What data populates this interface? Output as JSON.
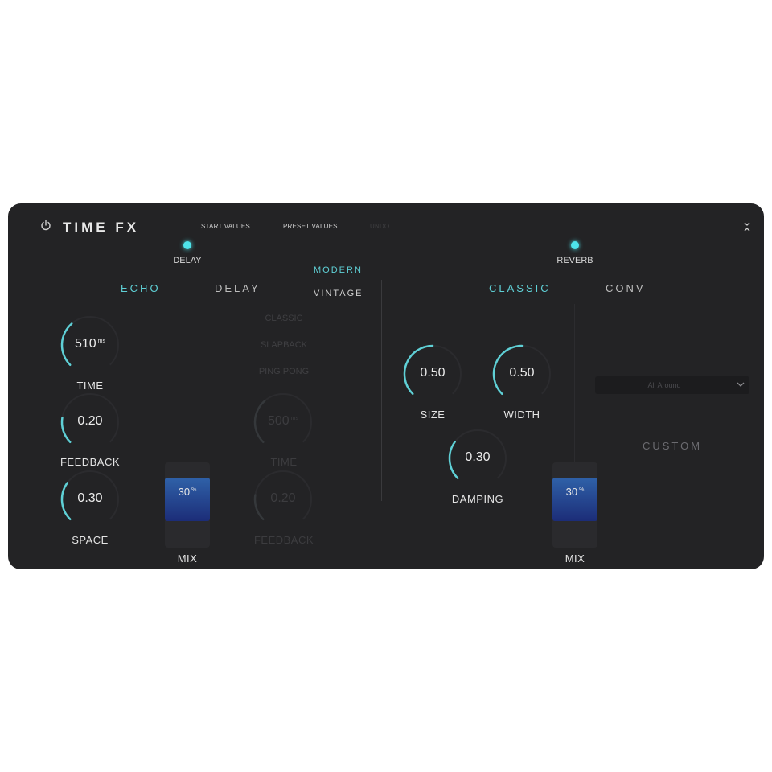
{
  "header": {
    "title": "TIME FX",
    "start_values": "START VALUES",
    "preset_values": "PRESET VALUES",
    "undo": "UNDO"
  },
  "delay": {
    "section_label": "DELAY",
    "tabs": {
      "echo": "ECHO",
      "delay": "DELAY"
    },
    "styles": {
      "modern": "MODERN",
      "vintage": "VINTAGE"
    },
    "delay_modes": [
      "CLASSIC",
      "SLAPBACK",
      "PING PONG"
    ],
    "knobs": {
      "time": {
        "value": "510",
        "unit": "ms",
        "label": "TIME",
        "level": 0.35
      },
      "feedback": {
        "value": "0.20",
        "label": "FEEDBACK",
        "level": 0.2
      },
      "space": {
        "value": "0.30",
        "label": "SPACE",
        "level": 0.3
      },
      "delay_time": {
        "value": "500",
        "unit": "ms",
        "label": "TIME",
        "level": 0.35
      },
      "delay_feedback": {
        "value": "0.20",
        "label": "FEEDBACK",
        "level": 0.2
      }
    },
    "mix": {
      "value": "30",
      "unit": "%",
      "label": "MIX",
      "level": 0.3
    }
  },
  "reverb": {
    "section_label": "REVERB",
    "tabs": {
      "classic": "CLASSIC",
      "conv": "CONV"
    },
    "knobs": {
      "size": {
        "value": "0.50",
        "label": "SIZE",
        "level": 0.5
      },
      "width": {
        "value": "0.50",
        "label": "WIDTH",
        "level": 0.5
      },
      "damping": {
        "value": "0.30",
        "label": "DAMPING",
        "level": 0.3
      }
    },
    "preset_dropdown": "All Around",
    "custom": "CUSTOM",
    "mix": {
      "value": "30",
      "unit": "%",
      "label": "MIX",
      "level": 0.3
    }
  },
  "colors": {
    "accent": "#5fd0d6",
    "panel": "#232325",
    "mix_fill": "#2f61a8"
  }
}
